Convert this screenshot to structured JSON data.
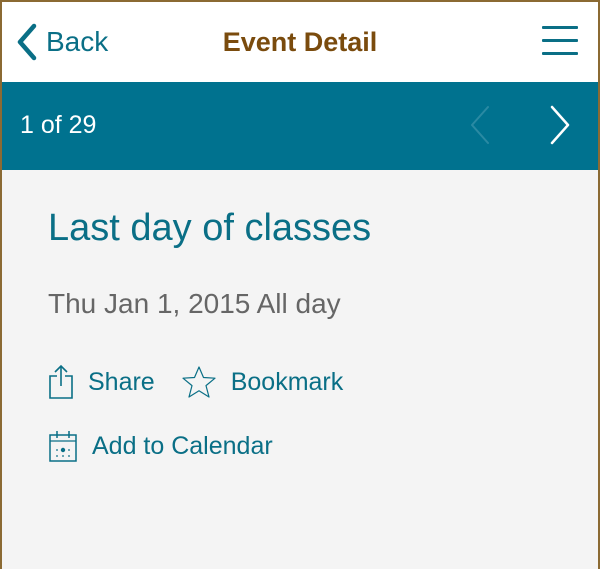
{
  "nav": {
    "back_label": "Back",
    "title": "Event Detail",
    "icons": {
      "back": "chevron-left-icon",
      "menu": "hamburger-menu-icon"
    }
  },
  "pager": {
    "position_text": "1 of 29",
    "icons": {
      "prev": "chevron-left-icon",
      "next": "chevron-right-icon"
    }
  },
  "event": {
    "title": "Last day of classes",
    "date": "Thu Jan 1, 2015 All day"
  },
  "actions": {
    "share_label": "Share",
    "bookmark_label": "Bookmark",
    "add_calendar_label": "Add to Calendar",
    "icons": {
      "share": "share-icon",
      "bookmark": "star-icon",
      "calendar": "calendar-icon"
    }
  },
  "colors": {
    "accent": "#0a6f86",
    "title_brown": "#7a4b0d",
    "pager_bg": "#00728f",
    "frame_border": "#8b6a33",
    "date_gray": "#666666",
    "content_bg": "#f4f4f4"
  }
}
